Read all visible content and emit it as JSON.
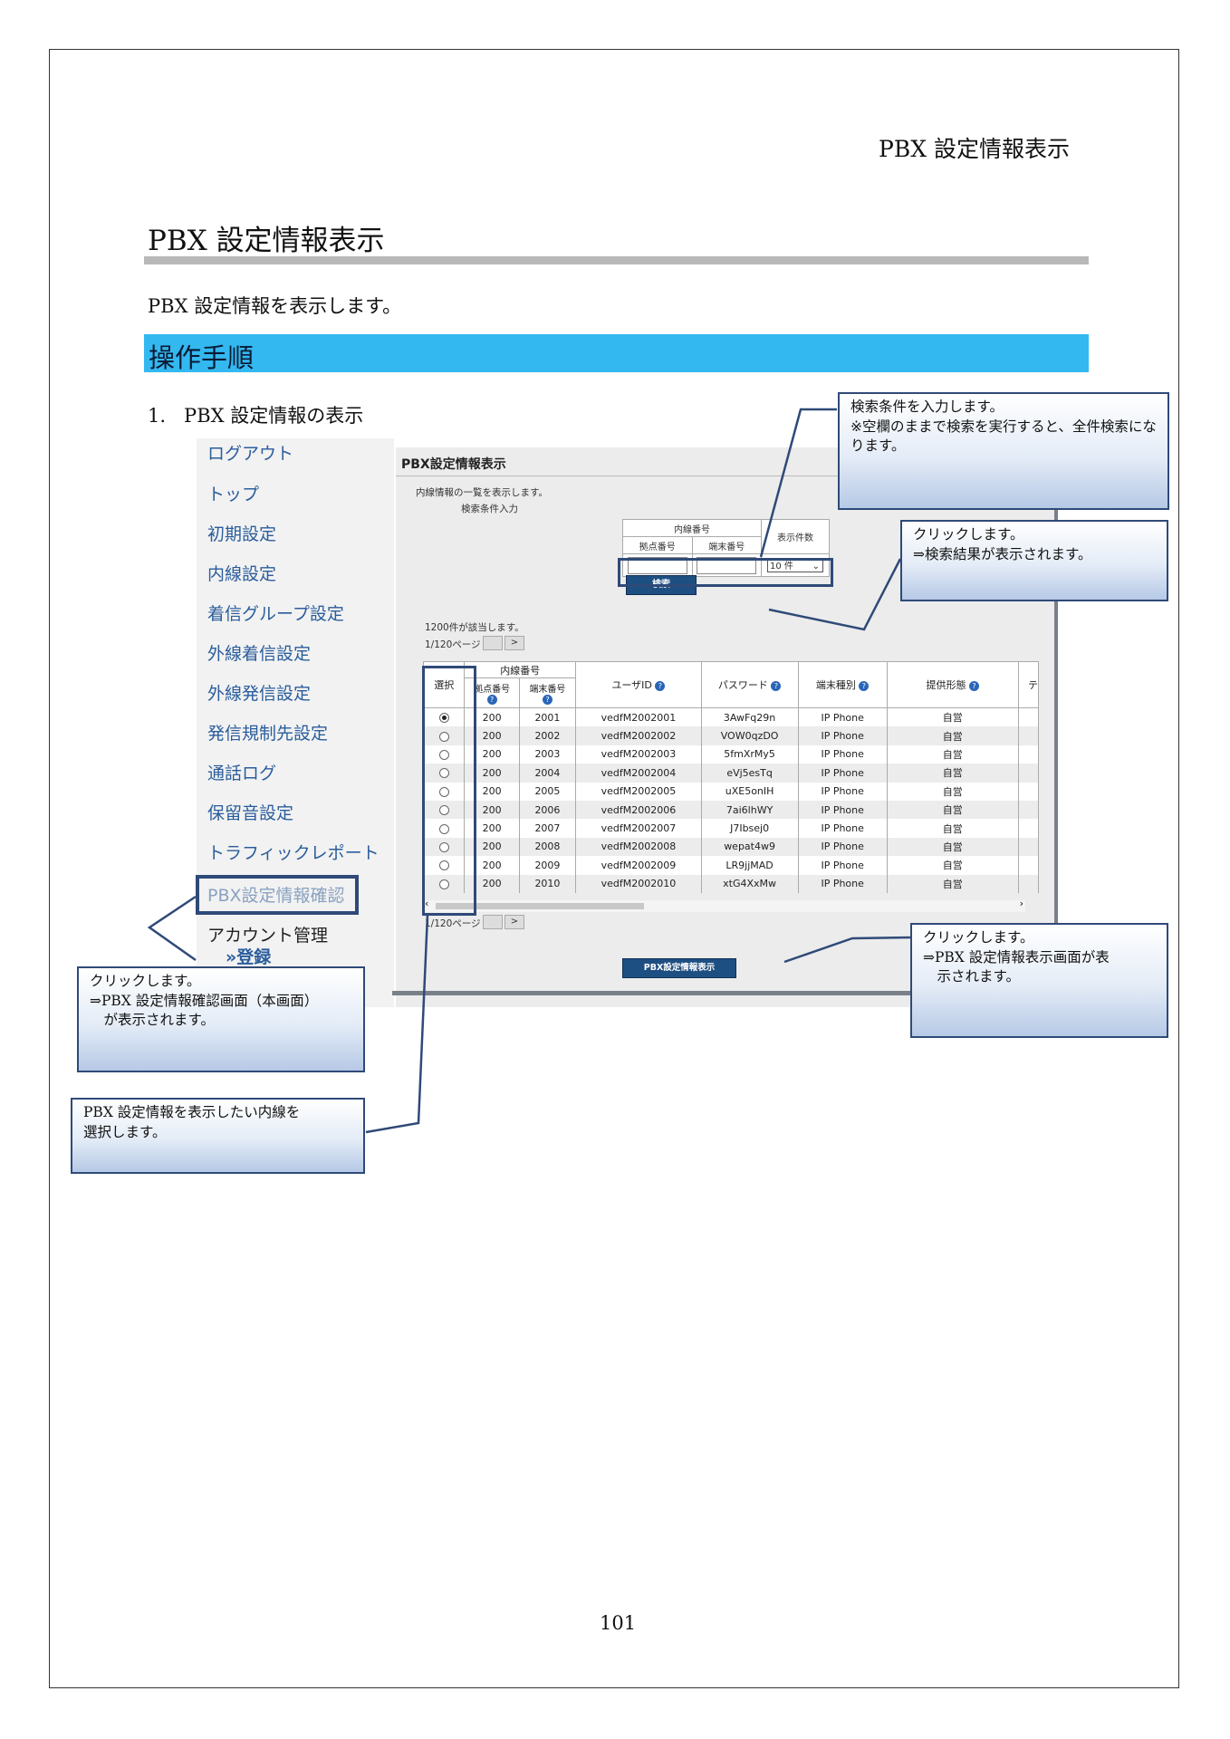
{
  "page": {
    "header_title": "PBX 設定情報表示",
    "section_title": "PBX 設定情報表示",
    "intro": "PBX 設定情報を表示します。",
    "steps_heading": "操作手順",
    "step1": "1.   PBX 設定情報の表示",
    "page_number": "101"
  },
  "sidebar": {
    "items": [
      "ログアウト",
      "トップ",
      "初期設定",
      "内線設定",
      "着信グループ設定",
      "外線着信設定",
      "外線発信設定",
      "発信規制先設定",
      "通話ログ",
      "保留音設定",
      "トラフィックレポート",
      "PBX設定情報確認",
      "アカウント管理",
      "»登録"
    ]
  },
  "screen": {
    "title": "PBX設定情報表示",
    "desc": "内線情報の一覧を表示します。",
    "search_label": "検索条件入力",
    "search": {
      "group_header": "内線番号",
      "col_base": "拠点番号",
      "col_terminal": "端末番号",
      "col_count": "表示件数",
      "count_value": "10 件",
      "search_button": "検索"
    },
    "result_count": "1200件が該当します。",
    "page_indicator": "1/120ページ",
    "next_label": ">",
    "table": {
      "headers": {
        "select": "選択",
        "ext_group": "内線番号",
        "base": "拠点番号",
        "terminal": "端末番号",
        "user_id": "ユーザID",
        "password": "パスワード",
        "terminal_type": "端末種別",
        "service": "提供形態",
        "extra": "テ"
      },
      "rows": [
        {
          "selected": true,
          "base": "200",
          "ext": "2001",
          "user": "vedfM2002001",
          "pw": "3AwFq29n",
          "type": "IP Phone",
          "svc": "自営"
        },
        {
          "selected": false,
          "base": "200",
          "ext": "2002",
          "user": "vedfM2002002",
          "pw": "VOW0qzDO",
          "type": "IP Phone",
          "svc": "自営"
        },
        {
          "selected": false,
          "base": "200",
          "ext": "2003",
          "user": "vedfM2002003",
          "pw": "5fmXrMy5",
          "type": "IP Phone",
          "svc": "自営"
        },
        {
          "selected": false,
          "base": "200",
          "ext": "2004",
          "user": "vedfM2002004",
          "pw": "eVj5esTq",
          "type": "IP Phone",
          "svc": "自営"
        },
        {
          "selected": false,
          "base": "200",
          "ext": "2005",
          "user": "vedfM2002005",
          "pw": "uXE5onIH",
          "type": "IP Phone",
          "svc": "自営"
        },
        {
          "selected": false,
          "base": "200",
          "ext": "2006",
          "user": "vedfM2002006",
          "pw": "7ai6lhWY",
          "type": "IP Phone",
          "svc": "自営"
        },
        {
          "selected": false,
          "base": "200",
          "ext": "2007",
          "user": "vedfM2002007",
          "pw": "J7Ibsej0",
          "type": "IP Phone",
          "svc": "自営"
        },
        {
          "selected": false,
          "base": "200",
          "ext": "2008",
          "user": "vedfM2002008",
          "pw": "wepat4w9",
          "type": "IP Phone",
          "svc": "自営"
        },
        {
          "selected": false,
          "base": "200",
          "ext": "2009",
          "user": "vedfM2002009",
          "pw": "LR9jjMAD",
          "type": "IP Phone",
          "svc": "自営"
        },
        {
          "selected": false,
          "base": "200",
          "ext": "2010",
          "user": "vedfM2002010",
          "pw": "xtG4XxMw",
          "type": "IP Phone",
          "svc": "自営"
        }
      ]
    },
    "display_button": "PBX設定情報表示"
  },
  "callouts": {
    "search_condition": "検索条件を入力します。\n※空欄のままで検索を実行すると、全件検索になります。",
    "search_click": "クリックします。\n⇒検索結果が表示されます。",
    "display_click": "クリックします。\n⇒PBX 設定情報表示画面が表\n　示されます。",
    "menu_click": "クリックします。\n⇒PBX 設定情報確認画面（本画面）\n　が表示されます。",
    "select_line": "PBX 設定情報を表示したい内線を\n選択します。"
  },
  "colors": {
    "steps_bar": "#33b8f0",
    "callout_border": "#2f4a78",
    "button_blue": "#1e4f82"
  }
}
